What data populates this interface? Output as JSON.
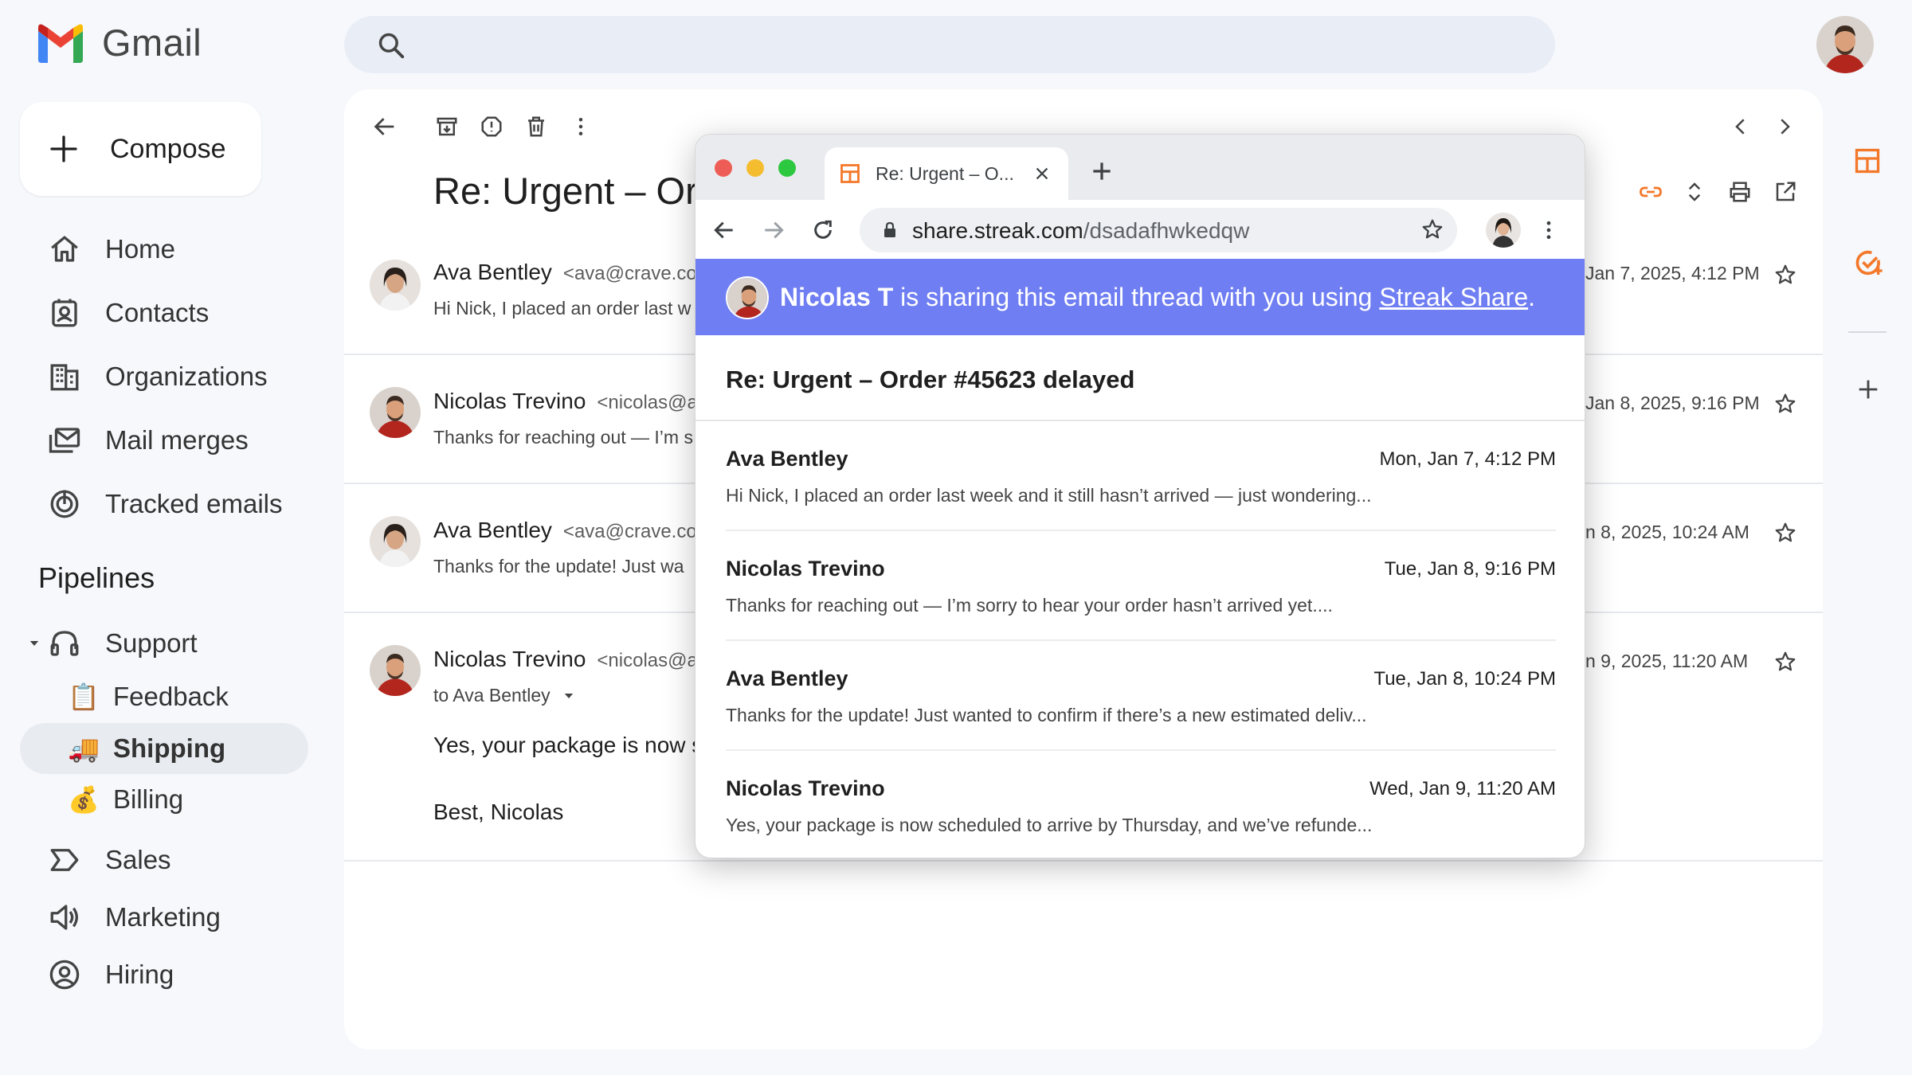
{
  "app": {
    "name": "Gmail"
  },
  "compose": {
    "label": "Compose"
  },
  "nav": [
    {
      "label": "Home",
      "icon": "home-icon"
    },
    {
      "label": "Contacts",
      "icon": "contacts-icon"
    },
    {
      "label": "Organizations",
      "icon": "building-icon"
    },
    {
      "label": "Mail merges",
      "icon": "mail-merge-icon"
    },
    {
      "label": "Tracked emails",
      "icon": "tracked-icon"
    }
  ],
  "pipelines": {
    "heading": "Pipelines",
    "support": {
      "label": "Support"
    },
    "stages": [
      {
        "emoji": "📋",
        "label": "Feedback"
      },
      {
        "emoji": "🚚",
        "label": "Shipping",
        "active": true
      },
      {
        "emoji": "💰",
        "label": "Billing"
      }
    ],
    "others": [
      {
        "label": "Sales",
        "icon": "pipeline-icon"
      },
      {
        "label": "Marketing",
        "icon": "megaphone-icon"
      },
      {
        "label": "Hiring",
        "icon": "person-circle-icon"
      }
    ]
  },
  "thread": {
    "subject_visible": "Re: Urgent – Or",
    "messages": [
      {
        "sender": "Ava Bentley",
        "email": "<ava@crave.co",
        "snippet": "Hi Nick, I placed an order last w",
        "date": "Jan 7, 2025, 4:12 PM"
      },
      {
        "sender": "Nicolas Trevino",
        "email": "<nicolas@a",
        "snippet": "Thanks for reaching out — I’m s",
        "date": "Jan 8, 2025, 9:16 PM"
      },
      {
        "sender": "Ava Bentley",
        "email": "<ava@crave.co",
        "snippet": "Thanks for the update! Just wa",
        "date": "n 8, 2025, 10:24 AM"
      },
      {
        "sender": "Nicolas Trevino",
        "email": "<nicolas@a",
        "to": "to Ava Bentley",
        "date": "n 9, 2025, 11:20 AM",
        "body": "Yes, your package is now s",
        "body_tail": ".",
        "signoff": "Best, Nicolas"
      }
    ]
  },
  "browser": {
    "tab_title": "Re: Urgent – O...",
    "url_host": "share.streak.com",
    "url_path": "/dsadafhwkedqw",
    "banner": {
      "name": "Nicolas T",
      "text": " is sharing this email thread with you using ",
      "link": "Streak Share",
      "end": "."
    },
    "subject": "Re: Urgent – Order #45623 delayed",
    "items": [
      {
        "sender": "Ava Bentley",
        "date": "Mon, Jan 7, 4:12 PM",
        "snippet": "Hi Nick, I placed an order last week and it still hasn’t arrived — just wondering..."
      },
      {
        "sender": "Nicolas Trevino",
        "date": "Tue, Jan 8, 9:16 PM",
        "snippet": "Thanks for reaching out — I’m sorry to hear your order hasn’t arrived yet...."
      },
      {
        "sender": "Ava Bentley",
        "date": "Tue, Jan 8, 10:24 PM",
        "snippet": "Thanks for the update! Just wanted to confirm if there’s a new estimated deliv..."
      },
      {
        "sender": "Nicolas Trevino",
        "date": "Wed, Jan 9, 11:20 AM",
        "snippet": "Yes, your package is now scheduled to arrive by Thursday, and we’ve refunde..."
      }
    ]
  },
  "colors": {
    "accent": "#6f7ef2",
    "streak_orange": "#f4782a",
    "active_bg": "#e8ebf0"
  }
}
